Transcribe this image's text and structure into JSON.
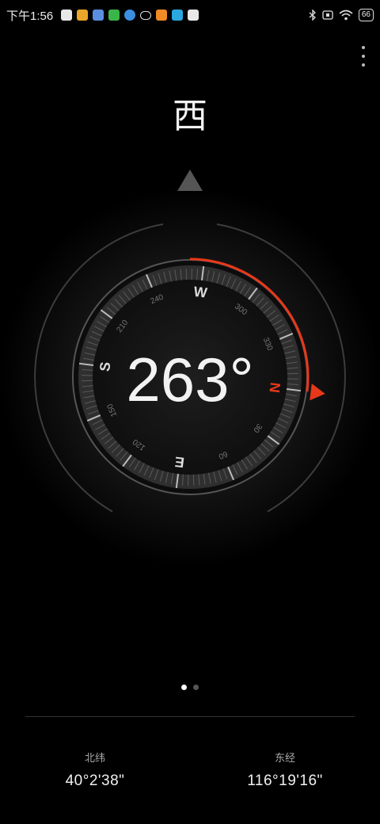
{
  "status_bar": {
    "time": "下午1:56",
    "battery": "66",
    "app_icon_colors": [
      "#e8e8e8",
      "#e9a628",
      "#5b8ee0",
      "#3bb54a",
      "#3a8fe0",
      "#e8e8e8",
      "#f08a24",
      "#2aa8e0",
      "#e8e8e8"
    ]
  },
  "header": {
    "direction": "西"
  },
  "compass": {
    "heading_value": 263,
    "heading_text": "263°",
    "cardinals": {
      "north": "N",
      "east": "E",
      "south": "S",
      "west": "W"
    },
    "degree_labels": [
      "240",
      "300",
      "330",
      "30",
      "60",
      "120",
      "150",
      "210"
    ],
    "accent_color": "#e8381a"
  },
  "pager": {
    "total": 2,
    "active": 0
  },
  "location": {
    "latitude_label": "北纬",
    "latitude_value": "40°2'38\"",
    "longitude_label": "东经",
    "longitude_value": "116°19'16\""
  }
}
